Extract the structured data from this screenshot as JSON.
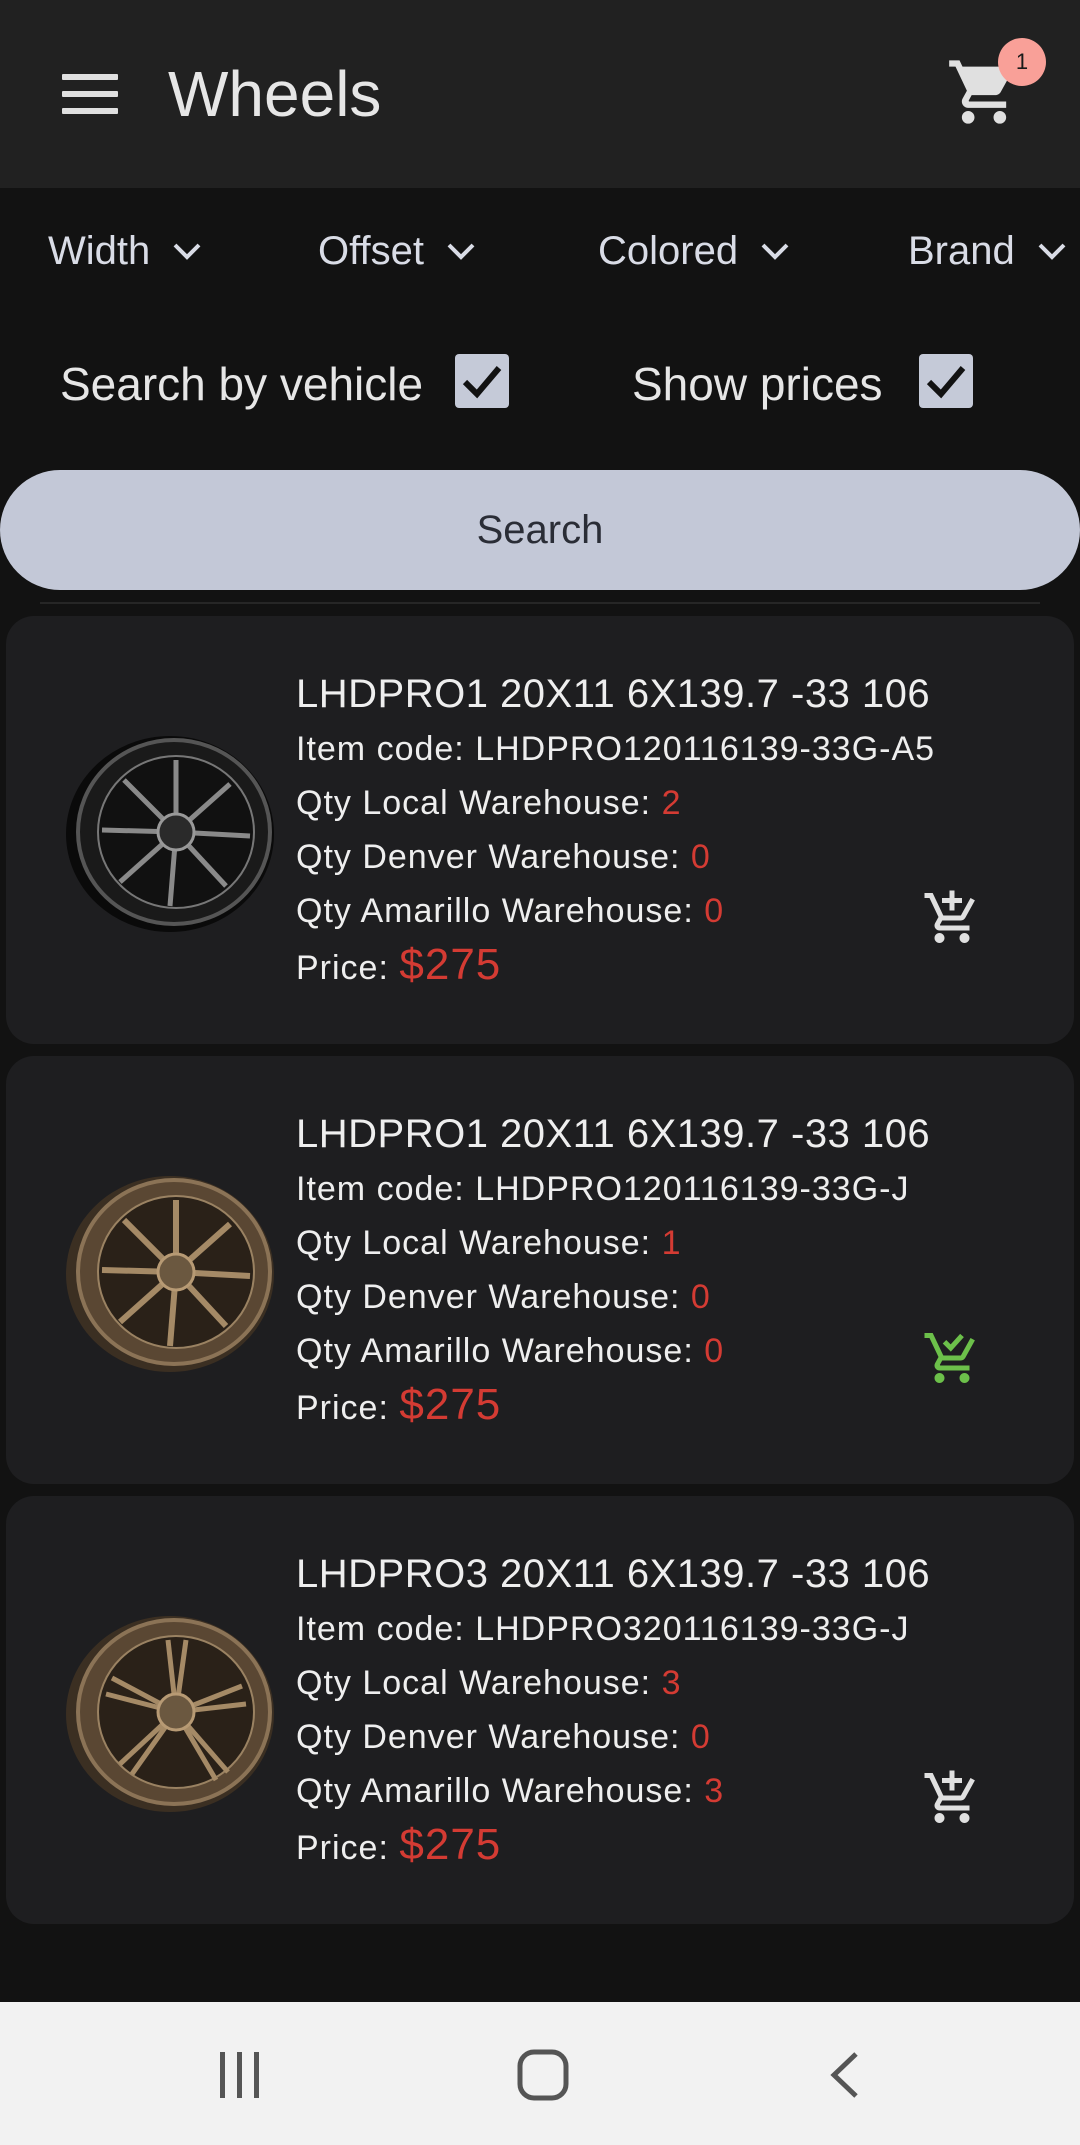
{
  "app_bar": {
    "title": "Wheels",
    "cart_count": "1"
  },
  "filters": [
    "Width",
    "Offset",
    "Colored",
    "Brand"
  ],
  "options": {
    "search_by_vehicle": "Search by vehicle",
    "show_prices": "Show prices"
  },
  "search_label": "Search",
  "products": [
    {
      "name": "LHDPRO1  20X11 6X139.7 -33 106",
      "item_code_label": "Item code:",
      "item_code": "LHDPRO120116139-33G-A5",
      "local_label": "Qty Local Warehouse:",
      "local": "2",
      "denver_label": "Qty Denver Warehouse:",
      "denver": "0",
      "amarillo_label": "Qty Amarillo Warehouse:",
      "amarillo": "0",
      "price_label": "Price:",
      "price": "$275",
      "finish": "black",
      "in_cart": false
    },
    {
      "name": "LHDPRO1  20X11 6X139.7 -33 106",
      "item_code_label": "Item code:",
      "item_code": "LHDPRO120116139-33G-J",
      "local_label": "Qty Local Warehouse:",
      "local": "1",
      "denver_label": "Qty Denver Warehouse:",
      "denver": "0",
      "amarillo_label": "Qty Amarillo Warehouse:",
      "amarillo": "0",
      "price_label": "Price:",
      "price": "$275",
      "finish": "bronze",
      "in_cart": true
    },
    {
      "name": "LHDPRO3  20X11 6X139.7 -33 106",
      "item_code_label": "Item code:",
      "item_code": "LHDPRO320116139-33G-J",
      "local_label": "Qty Local Warehouse:",
      "local": "3",
      "denver_label": "Qty Denver Warehouse:",
      "denver": "0",
      "amarillo_label": "Qty Amarillo Warehouse:",
      "amarillo": "3",
      "price_label": "Price:",
      "price": "$275",
      "finish": "bronze",
      "in_cart": false
    }
  ],
  "colors": {
    "price": "#d43b33",
    "in_cart": "#6cc04a",
    "cart_icon": "#e0e0e0",
    "badge": "#f9a098"
  },
  "system_nav": [
    "recent-apps-icon",
    "home-icon",
    "back-icon"
  ]
}
